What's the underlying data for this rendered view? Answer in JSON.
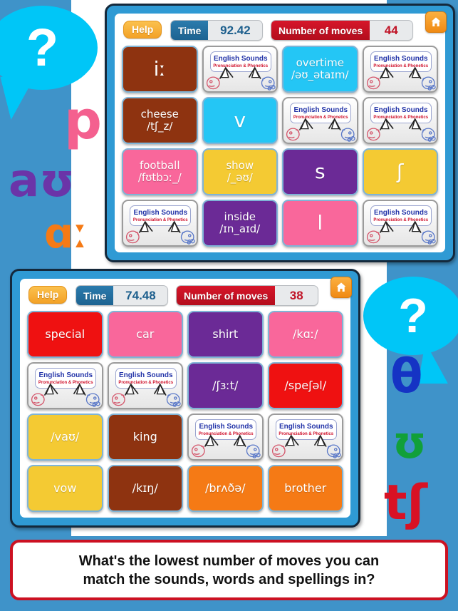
{
  "background": {
    "base_color": "#3f93c9",
    "slide_color": "#ffffff",
    "bubble_color": "#00c6f7",
    "bubble_glyph": "?"
  },
  "decorations": {
    "left": [
      {
        "name": "ipa-p",
        "text": "p",
        "color": "#f4608f"
      },
      {
        "name": "ipa-au",
        "text": "aʊ",
        "color": "#6b34a8"
      },
      {
        "name": "ipa-aa",
        "text": "ɑː",
        "color": "#f57a15"
      }
    ],
    "right": [
      {
        "name": "ipa-theta",
        "text": "θ",
        "color": "#1533c4"
      },
      {
        "name": "ipa-upsilon",
        "text": "ʊ",
        "color": "#11a03a"
      },
      {
        "name": "ipa-tsh",
        "text": "tʃ",
        "color": "#d81124"
      }
    ]
  },
  "logo": {
    "line1": "English Sounds",
    "line2": "Pronunciation & Phonetics"
  },
  "panels": [
    {
      "name": "game-panel-top",
      "hud": {
        "help_label": "Help",
        "time_label": "Time",
        "time_value": "92.42",
        "moves_label": "Number of moves",
        "moves_value": "44",
        "home_icon": "home-icon"
      },
      "tiles": [
        {
          "type": "face",
          "color": "#8e3310",
          "lines": [
            "iː"
          ],
          "style": "sym"
        },
        {
          "type": "back"
        },
        {
          "type": "face",
          "color": "#24c6f5",
          "lines": [
            "overtime",
            "/əʊ_ətaɪm/"
          ],
          "style": "two"
        },
        {
          "type": "back"
        },
        {
          "type": "face",
          "color": "#8e3310",
          "lines": [
            "cheese",
            "/tʃ_z/"
          ],
          "style": "two"
        },
        {
          "type": "face",
          "color": "#24c6f5",
          "lines": [
            "v"
          ],
          "style": "sym"
        },
        {
          "type": "back"
        },
        {
          "type": "back"
        },
        {
          "type": "face",
          "color": "#f9679b",
          "lines": [
            "football",
            "/fʊtbɔː_/"
          ],
          "style": "two"
        },
        {
          "type": "face",
          "color": "#f4ca33",
          "lines": [
            "show",
            "/_əʊ/"
          ],
          "style": "two"
        },
        {
          "type": "face",
          "color": "#6b2a96",
          "lines": [
            "s"
          ],
          "style": "sym"
        },
        {
          "type": "face",
          "color": "#f4ca33",
          "lines": [
            "ʃ"
          ],
          "style": "sym"
        },
        {
          "type": "back"
        },
        {
          "type": "face",
          "color": "#6b2a96",
          "lines": [
            "inside",
            "/ɪn_aɪd/"
          ],
          "style": "two"
        },
        {
          "type": "face",
          "color": "#f9679b",
          "lines": [
            "l"
          ],
          "style": "sym"
        },
        {
          "type": "back"
        }
      ]
    },
    {
      "name": "game-panel-bottom",
      "hud": {
        "help_label": "Help",
        "time_label": "Time",
        "time_value": "74.48",
        "moves_label": "Number of moves",
        "moves_value": "38",
        "home_icon": "home-icon"
      },
      "tiles": [
        {
          "type": "face",
          "color": "#ef1111",
          "lines": [
            "special"
          ],
          "style": "one"
        },
        {
          "type": "face",
          "color": "#f9679b",
          "lines": [
            "car"
          ],
          "style": "one"
        },
        {
          "type": "face",
          "color": "#6b2a96",
          "lines": [
            "shirt"
          ],
          "style": "one"
        },
        {
          "type": "face",
          "color": "#f9679b",
          "lines": [
            "/kɑː/"
          ],
          "style": "one"
        },
        {
          "type": "back"
        },
        {
          "type": "back"
        },
        {
          "type": "face",
          "color": "#6b2a96",
          "lines": [
            "/ʃɜːt/"
          ],
          "style": "one"
        },
        {
          "type": "face",
          "color": "#ef1111",
          "lines": [
            "/speʃəl/"
          ],
          "style": "one"
        },
        {
          "type": "face",
          "color": "#f4ca33",
          "lines": [
            "/vaʊ/"
          ],
          "style": "one"
        },
        {
          "type": "face",
          "color": "#8e3310",
          "lines": [
            "king"
          ],
          "style": "one"
        },
        {
          "type": "back"
        },
        {
          "type": "back"
        },
        {
          "type": "face",
          "color": "#f4ca33",
          "lines": [
            "vow"
          ],
          "style": "one"
        },
        {
          "type": "face",
          "color": "#8e3310",
          "lines": [
            "/kɪŋ/"
          ],
          "style": "one"
        },
        {
          "type": "face",
          "color": "#f57a15",
          "lines": [
            "/brʌðə/"
          ],
          "style": "one"
        },
        {
          "type": "face",
          "color": "#f57a15",
          "lines": [
            "brother"
          ],
          "style": "one"
        }
      ]
    }
  ],
  "caption": {
    "line1": "What's the lowest number of moves you can",
    "line2": "match the sounds, words and spellings in?",
    "border_color": "#cc1122"
  }
}
